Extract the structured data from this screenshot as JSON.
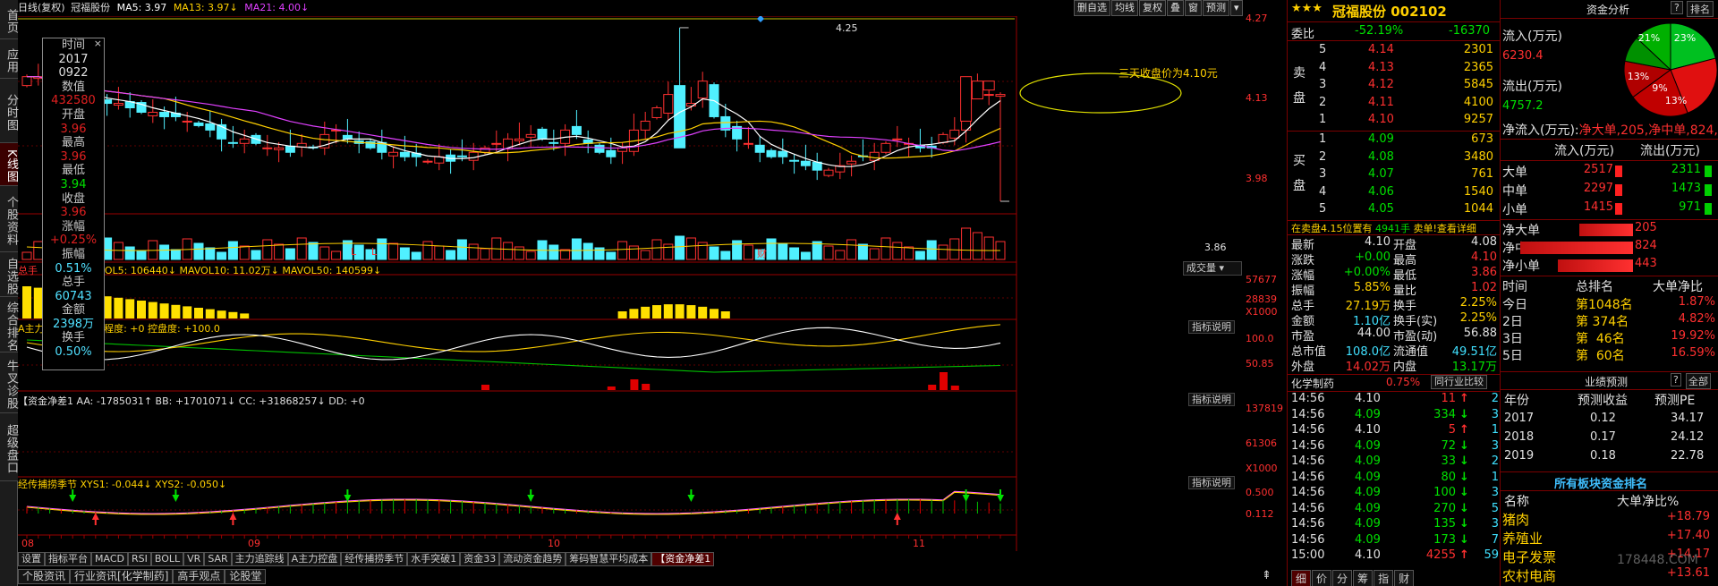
{
  "title": {
    "prefix": "日线(复权)",
    "stock": "冠福股份",
    "ma5": "MA5: 3.97",
    "ma13": "MA13: 3.97↓",
    "ma21": "MA21: 4.00↓"
  },
  "topbuttons": [
    "删自选",
    "均线",
    "复权",
    "叠",
    "窗",
    "预测",
    "▾"
  ],
  "leftnav": [
    "首页",
    "应用",
    "分时图",
    "K线图",
    "个股资料",
    "自选股",
    "综合排名",
    "牛叉诊股",
    "超级盘口"
  ],
  "datapanel": {
    "时间": "时间",
    "t1": "2017",
    "t2": "0922",
    "数值": "数值",
    "v": "432580",
    "开盘": "开盘",
    "open": "3.96",
    "最高": "最高",
    "high": "3.96",
    "最低": "最低",
    "low": "3.94",
    "收盘": "收盘",
    "close": "3.96",
    "涨幅": "涨幅",
    "chg": "+0.25%",
    "振幅": "振幅",
    "amp": "0.51%",
    "总手": "总手",
    "vol": "60743",
    "金额": "金额",
    "amt": "2398万",
    "换手": "换手",
    "turn": "0.50%"
  },
  "kchart": {
    "price_labels": [
      "4.27",
      "4.13",
      "3.98",
      "3.86"
    ],
    "peak": "4.25",
    "trough": "3.86",
    "annotation": "三天收盘价为4.10元",
    "markers": [
      "L",
      "L",
      "财"
    ]
  },
  "vol": {
    "label": "VOL5: 106440↓ MAVOL10: 11.02万↓ MAVOL50: 140599↓",
    "prefix": "总手",
    "right_btn": "成交量",
    "scale": [
      "57677",
      "28839",
      "X1000"
    ]
  },
  "ctrl": {
    "label": "A主力·控盘(3) 控盘程度: +0 控盘度: +100.0",
    "btn": "指标说明",
    "scale": [
      "100.0",
      "50.85"
    ]
  },
  "money": {
    "label": "【资金净差1 AA: -1785031↑ BB: +1701071↓ CC: +31868257↓ DD: +0",
    "btn": "指标说明",
    "scale": [
      "137819",
      "61306",
      "X1000"
    ]
  },
  "season": {
    "label": "经传捕捞季节 XYS1: -0.044↓ XYS2: -0.050↓",
    "btn": "指标说明",
    "scale": [
      "0.500",
      "0.112"
    ]
  },
  "xaxis": [
    "08",
    "09",
    "10",
    "11"
  ],
  "tabs": [
    "设置",
    "指标平台",
    "MACD",
    "RSI",
    "BOLL",
    "VR",
    "SAR",
    "主力追踪线",
    "A主力控盘",
    "经传捕捞季节",
    "水手突破1",
    "资金33",
    "流动资金趋势",
    "筹码智慧平均成本",
    "【资金净差1"
  ],
  "tabs2": [
    "个股资讯",
    "行业资讯[化学制药]",
    "高手观点",
    "论股堂"
  ],
  "quote": {
    "stars": "★★★",
    "name": "冠福股份",
    "code": "002102",
    "委比": "委比",
    "wb": "-52.19%",
    "wc": "-16370",
    "sell": [
      {
        "n": "5",
        "p": "4.14",
        "v": "2301"
      },
      {
        "n": "4",
        "p": "4.13",
        "v": "2365"
      },
      {
        "n": "3",
        "p": "4.12",
        "v": "5845"
      },
      {
        "n": "2",
        "p": "4.11",
        "v": "4100"
      },
      {
        "n": "1",
        "p": "4.10",
        "v": "9257"
      }
    ],
    "buy": [
      {
        "n": "1",
        "p": "4.09",
        "v": "673"
      },
      {
        "n": "2",
        "p": "4.08",
        "v": "3480"
      },
      {
        "n": "3",
        "p": "4.07",
        "v": "761"
      },
      {
        "n": "4",
        "p": "4.06",
        "v": "1540"
      },
      {
        "n": "5",
        "p": "4.05",
        "v": "1044"
      }
    ],
    "sell_label": "卖盘",
    "buy_label": "买盘",
    "notice1": "在卖盘4.15位置有",
    "notice2": "4941手",
    "notice3": "卖单!查看详细",
    "stats": [
      [
        "最新",
        "4.10",
        "开盘",
        "4.08"
      ],
      [
        "涨跌",
        "+0.00",
        "最高",
        "4.10"
      ],
      [
        "涨幅",
        "+0.00%",
        "最低",
        "3.86"
      ],
      [
        "振幅",
        "5.85%",
        "量比",
        "1.02"
      ],
      [
        "总手",
        "27.19万",
        "换手",
        "2.25%"
      ],
      [
        "金额",
        "1.10亿",
        "换手(实)",
        "2.25%"
      ],
      [
        "市盈",
        "44.00",
        "市盈(动)",
        "56.88"
      ],
      [
        "总市值",
        "108.0亿",
        "流通值",
        "49.51亿"
      ],
      [
        "外盘",
        "14.02万",
        "内盘",
        "13.17万"
      ]
    ],
    "industry": "化学制药",
    "ind_chg": "0.75%",
    "ind_btn": "同行业比较",
    "ticks": [
      [
        "14:56",
        "4.10",
        "11",
        "↑",
        "2"
      ],
      [
        "14:56",
        "4.09",
        "334",
        "↓",
        "3"
      ],
      [
        "14:56",
        "4.10",
        "5",
        "↑",
        "1"
      ],
      [
        "14:56",
        "4.09",
        "72",
        "↓",
        "3"
      ],
      [
        "14:56",
        "4.09",
        "33",
        "↓",
        "2"
      ],
      [
        "14:56",
        "4.09",
        "80",
        "↓",
        "1"
      ],
      [
        "14:56",
        "4.09",
        "100",
        "↓",
        "3"
      ],
      [
        "14:56",
        "4.09",
        "270",
        "↓",
        "5"
      ],
      [
        "14:56",
        "4.09",
        "135",
        "↓",
        "3"
      ],
      [
        "14:56",
        "4.09",
        "173",
        "↓",
        "7"
      ],
      [
        "15:00",
        "4.10",
        "4255",
        "↑",
        "59"
      ]
    ],
    "bottom_tabs": [
      "细",
      "价",
      "分",
      "筹",
      "指",
      "财"
    ]
  },
  "fund": {
    "title": "资金分析",
    "btn1": "?",
    "btn2": "排名",
    "in_label": "流入(万元)",
    "in": "6230.4",
    "out_label": "流出(万元)",
    "out": "4757.2",
    "net_label": "净流入(万元):",
    "net": [
      [
        "净大单",
        "205"
      ],
      [
        "净中单",
        "824"
      ],
      [
        "净小单",
        "443"
      ]
    ],
    "pie": [
      {
        "label": "21%",
        "v": 21
      },
      {
        "label": "23%",
        "v": 23
      },
      {
        "label": "13%",
        "v": 13
      },
      {
        "label": "9%",
        "v": 9
      },
      {
        "label": "13%",
        "v": 13
      }
    ],
    "hdr": [
      "流入(万元)",
      "流出(万元)"
    ],
    "rows": [
      [
        "大单",
        "2517",
        "2311"
      ],
      [
        "中单",
        "2297",
        "1473"
      ],
      [
        "小单",
        "1415",
        "971"
      ]
    ]
  },
  "rank": {
    "hdr": [
      "时间",
      "总排名",
      "大单净比"
    ],
    "rows": [
      [
        "今日",
        "第1048名",
        "1.87%"
      ],
      [
        "2日",
        "第 374名",
        "4.82%"
      ],
      [
        "3日",
        "第  46名",
        "19.92%"
      ],
      [
        "5日",
        "第  60名",
        "16.59%"
      ]
    ]
  },
  "forecast": {
    "title": "业绩预测",
    "btns": [
      "?",
      "|",
      "全部"
    ],
    "hdr": [
      "年份",
      "预测收益",
      "预测PE"
    ],
    "rows": [
      [
        "2017",
        "0.12",
        "34.17"
      ],
      [
        "2018",
        "0.17",
        "24.12"
      ],
      [
        "2019",
        "0.18",
        "22.78"
      ]
    ]
  },
  "sector": {
    "title": "所有板块资金排名",
    "hdr": [
      "名称",
      "大单净比%"
    ],
    "rows": [
      [
        "猪肉",
        "+18.79"
      ],
      [
        "养殖业",
        "+17.40"
      ],
      [
        "电子发票",
        "+14.17"
      ],
      [
        "农村电商",
        "+13.61"
      ]
    ],
    "watermark": "178448.COM"
  },
  "colors": {
    "up": "#ff3030",
    "down": "#50f0ff",
    "grid": "#7a0000"
  }
}
